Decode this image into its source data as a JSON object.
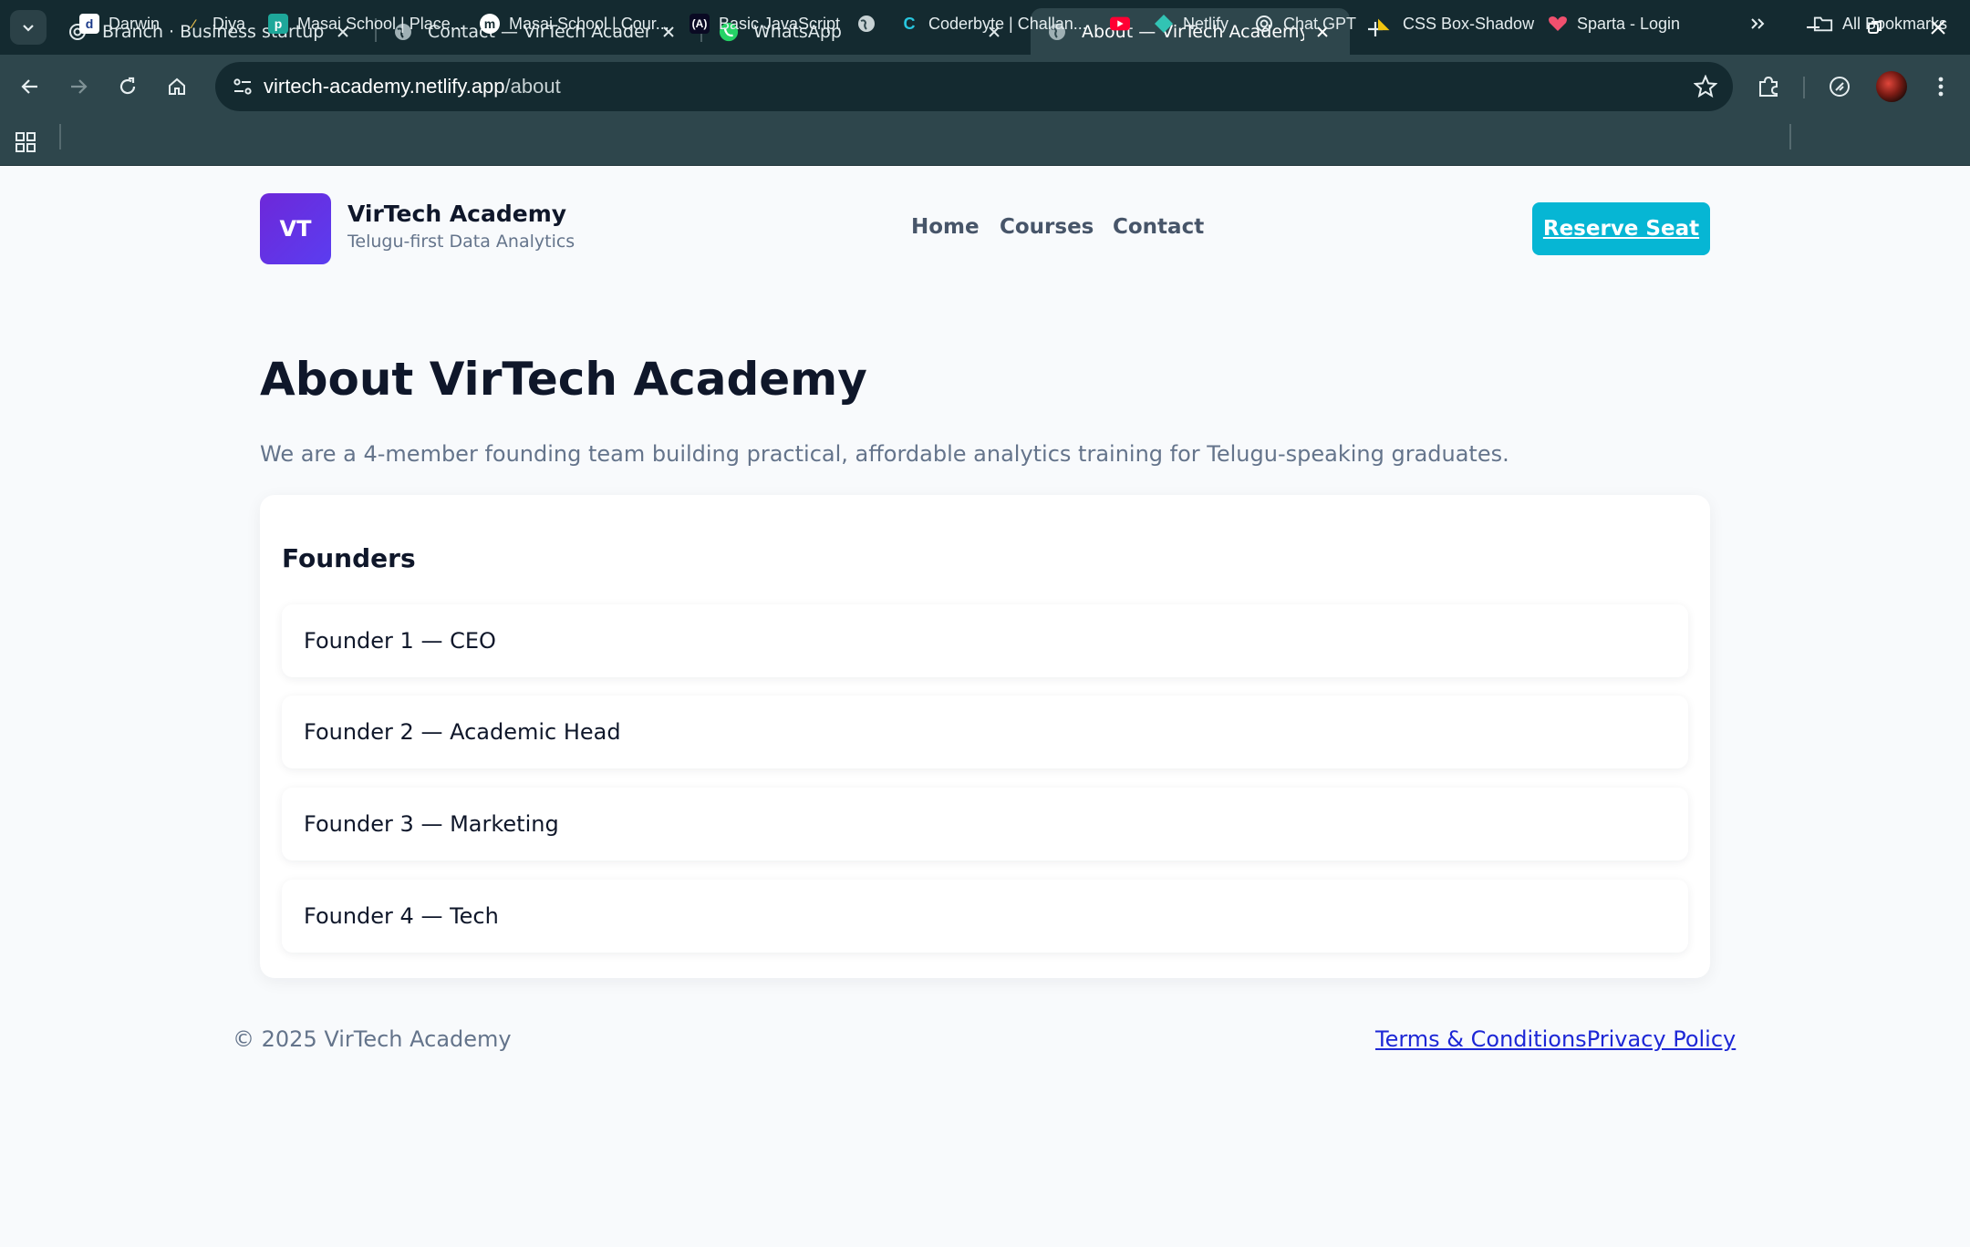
{
  "browser": {
    "tabs": [
      {
        "label": "Branch · Business startup roadm",
        "favicon": "openai-icon",
        "active": false
      },
      {
        "label": "Contact — VirTech Academy",
        "favicon": "globe-icon",
        "active": false
      },
      {
        "label": "WhatsApp",
        "favicon": "whatsapp-icon",
        "active": false
      },
      {
        "label": "About — VirTech Academy",
        "favicon": "globe-icon",
        "active": true
      }
    ],
    "url_host": "virtech-academy.netlify.app",
    "url_path": "/about",
    "bookmarks": [
      {
        "label": "Darwin",
        "icon": "darwin-icon"
      },
      {
        "label": "Diya",
        "icon": "diya-icon"
      },
      {
        "label": "Masai School | Place...",
        "icon": "masai-place-icon"
      },
      {
        "label": "Masai School | Cour...",
        "icon": "masai-course-icon"
      },
      {
        "label": "Basic JavaScript",
        "icon": "freecodecamp-icon"
      },
      {
        "label": "",
        "icon": "globe-icon"
      },
      {
        "label": "Coderbyte | Challan...",
        "icon": "coderbyte-icon"
      },
      {
        "label": "",
        "icon": "youtube-icon"
      },
      {
        "label": "Netlify",
        "icon": "netlify-icon"
      },
      {
        "label": "Chat GPT",
        "icon": "openai-icon"
      },
      {
        "label": "CSS Box-Shadow",
        "icon": "css-shadow-icon"
      },
      {
        "label": "Sparta - Login",
        "icon": "sparta-icon"
      }
    ],
    "all_bookmarks_label": "All Bookmarks"
  },
  "site": {
    "logo_text": "VT",
    "brand_name": "VirTech Academy",
    "brand_tagline": "Telugu-first Data Analytics",
    "nav": [
      "Home",
      "Courses",
      "Contact"
    ],
    "cta_label": "Reserve Seat",
    "accent_color": "#06b6d4",
    "logo_color": "#6d28d9"
  },
  "main": {
    "title": "About VirTech Academy",
    "lead": "We are a 4-member founding team building practical, affordable analytics training for Telugu-speaking graduates.",
    "founders_heading": "Founders",
    "founders": [
      "Founder 1 — CEO",
      "Founder 2 — Academic Head",
      "Founder 3 — Marketing",
      "Founder 4 — Tech"
    ]
  },
  "footer": {
    "copyright": "© 2025 VirTech Academy",
    "links": [
      "Terms & Conditions",
      "Privacy Policy"
    ]
  }
}
